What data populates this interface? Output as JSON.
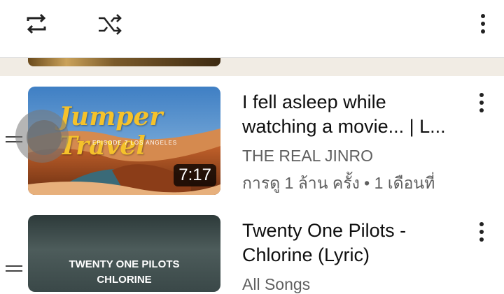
{
  "toolbar": {
    "repeat_icon": "repeat-icon",
    "shuffle_icon": "shuffle-icon",
    "more_icon": "more-vert-icon"
  },
  "playlist": [
    {
      "title_line1": "I fell asleep while",
      "title_line2": "watching a movie... | L...",
      "channel": "THE REAL JINRO",
      "stats": "การดู 1 ล้าน ครั้ง • 1 เดือนที่",
      "duration": "7:17",
      "thumb_title": "Jumper Travel",
      "thumb_subtitle": "EPISODE 7 LOS ANGELES"
    },
    {
      "title_line1": "Twenty One Pilots -",
      "title_line2": "Chlorine (Lyric)",
      "channel": "All Songs",
      "thumb_line1": "TWENTY ONE PILOTS",
      "thumb_line2": "CHLORINE"
    }
  ],
  "colors": {
    "accent_yellow": "#f5c22b",
    "text_secondary": "#606060",
    "prev_row_bg": "#f1ece4"
  }
}
